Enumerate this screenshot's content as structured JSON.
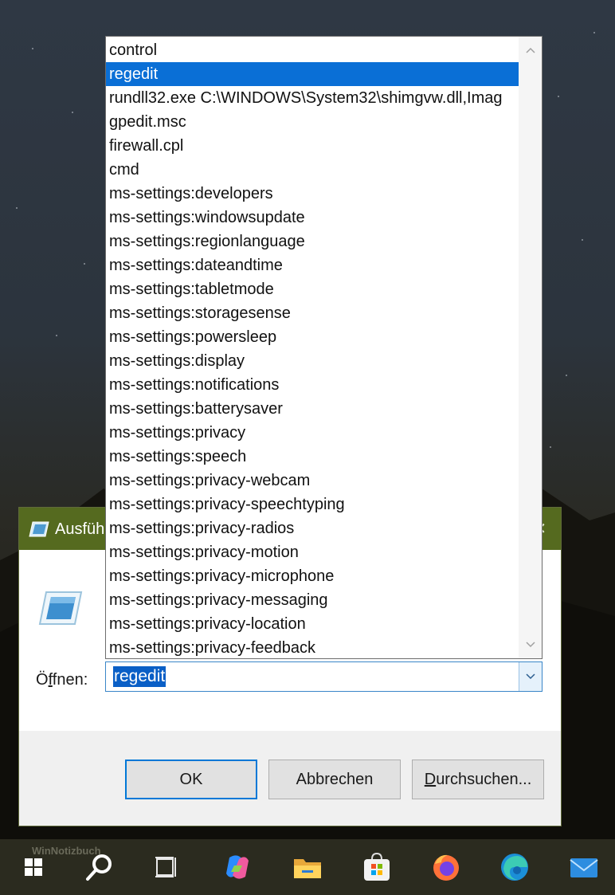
{
  "dialog": {
    "title": "Ausfüh",
    "open_label_prefix": "Ö",
    "open_label_underline": "f",
    "open_label_suffix": "fnen:",
    "combo_value": "regedit",
    "buttons": {
      "ok": "OK",
      "cancel": "Abbrechen",
      "browse_underline": "D",
      "browse_rest": "urchsuchen..."
    }
  },
  "dropdown": {
    "items": [
      "control",
      "regedit",
      "rundll32.exe C:\\WINDOWS\\System32\\shimgvw.dll,Imag",
      "gpedit.msc",
      "firewall.cpl",
      "cmd",
      "ms-settings:developers",
      "ms-settings:windowsupdate",
      "ms-settings:regionlanguage",
      "ms-settings:dateandtime",
      "ms-settings:tabletmode",
      "ms-settings:storagesense",
      "ms-settings:powersleep",
      "ms-settings:display",
      "ms-settings:notifications",
      "ms-settings:batterysaver",
      "ms-settings:privacy",
      "ms-settings:speech",
      "ms-settings:privacy-webcam",
      "ms-settings:privacy-speechtyping",
      "ms-settings:privacy-radios",
      "ms-settings:privacy-motion",
      "ms-settings:privacy-microphone",
      "ms-settings:privacy-messaging",
      "ms-settings:privacy-location",
      "ms-settings:privacy-feedback"
    ],
    "selected_item": "regedit"
  },
  "taskbar": {
    "watermark": "WinNotizbuch",
    "icons": [
      "windows-start-icon",
      "search-icon",
      "task-view-icon",
      "copilot-icon",
      "file-explorer-icon",
      "microsoft-store-icon",
      "firefox-icon",
      "edge-icon",
      "mail-icon"
    ]
  },
  "colors": {
    "titlebar": "#556a1f",
    "selection": "#0a6fd6",
    "focus_border": "#0078d7"
  }
}
